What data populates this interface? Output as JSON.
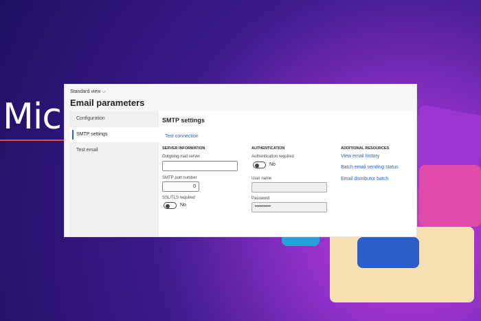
{
  "background": {
    "brand_text": "Mic"
  },
  "header": {
    "view_label": "Standard view",
    "view_chevron": "chevron-down-icon",
    "title": "Email parameters"
  },
  "nav": {
    "items": [
      {
        "label": "Configuration"
      },
      {
        "label": "SMTP settings",
        "active": true
      },
      {
        "label": "Test email"
      }
    ]
  },
  "main": {
    "heading": "SMTP settings",
    "test_connection": "Test connection",
    "server": {
      "section": "SERVER INFORMATION",
      "outgoing_label": "Outgoing mail server",
      "outgoing_value": "",
      "port_label": "SMTP port number",
      "port_value": "0",
      "ssl_label": "SSL/TLS required",
      "ssl_value": "No"
    },
    "auth": {
      "section": "AUTHENTICATION",
      "required_label": "Authentication required",
      "required_value": "No",
      "user_label": "User name",
      "user_value": "",
      "password_label": "Password",
      "password_value": "•••••••••••"
    },
    "resources": {
      "section": "ADDITIONAL RESOURCES",
      "links": [
        "View email history",
        "Batch email sending status",
        "Email distributor batch"
      ]
    }
  },
  "colors": {
    "accent": "#2a63c8"
  }
}
